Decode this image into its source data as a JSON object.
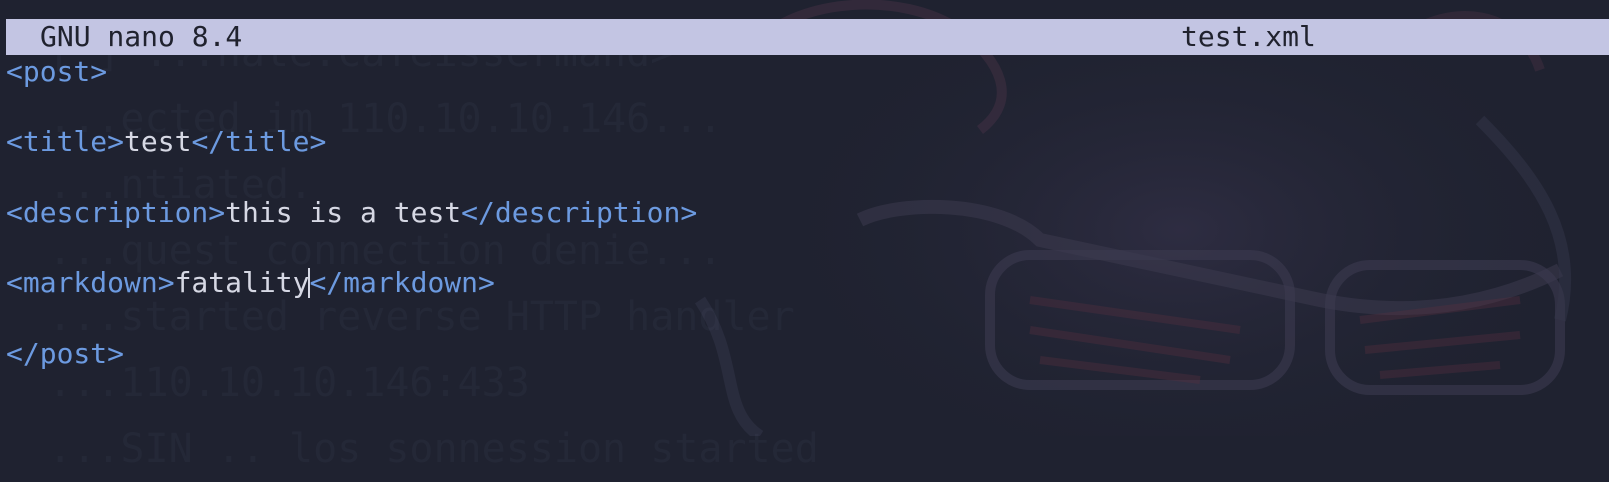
{
  "window": {
    "app_name": "GNU nano 8.4",
    "file_name": "test.xml"
  },
  "editor": {
    "lines": [
      {
        "parts": [
          {
            "text": "<post>",
            "kind": "tag"
          }
        ]
      },
      {
        "parts": []
      },
      {
        "parts": [
          {
            "text": "<title>",
            "kind": "tag"
          },
          {
            "text": "test",
            "kind": "text"
          },
          {
            "text": "</title>",
            "kind": "tag"
          }
        ]
      },
      {
        "parts": []
      },
      {
        "parts": [
          {
            "text": "<description>",
            "kind": "tag"
          },
          {
            "text": "this is a test",
            "kind": "text"
          },
          {
            "text": "</description>",
            "kind": "tag"
          }
        ]
      },
      {
        "parts": []
      },
      {
        "parts": [
          {
            "text": "<markdown>",
            "kind": "tag"
          },
          {
            "text": "fatality",
            "kind": "text"
          },
          {
            "text": "</markdown>",
            "kind": "tag"
          }
        ]
      },
      {
        "parts": []
      },
      {
        "parts": [
          {
            "text": "</post>",
            "kind": "tag"
          }
        ]
      }
    ],
    "cursor_line": 6,
    "cursor_after_part": 1
  },
  "background": {
    "ghost_lines": [
      "  [*] ...nate:cafeissermand>",
      "  ...ected im 110.10.10.146...",
      "  ...ntiated.",
      "  ...quest connection denie...",
      "  ...started reverse HTTP handler",
      "  ...110.10.10.146:433",
      "  ...SIN .. los sonnession started"
    ]
  },
  "colors": {
    "background": "#1f2230",
    "titlebar_bg": "#c3c5e3",
    "titlebar_fg": "#20222e",
    "tag": "#6c9ae0",
    "text": "#d6d8e4"
  }
}
